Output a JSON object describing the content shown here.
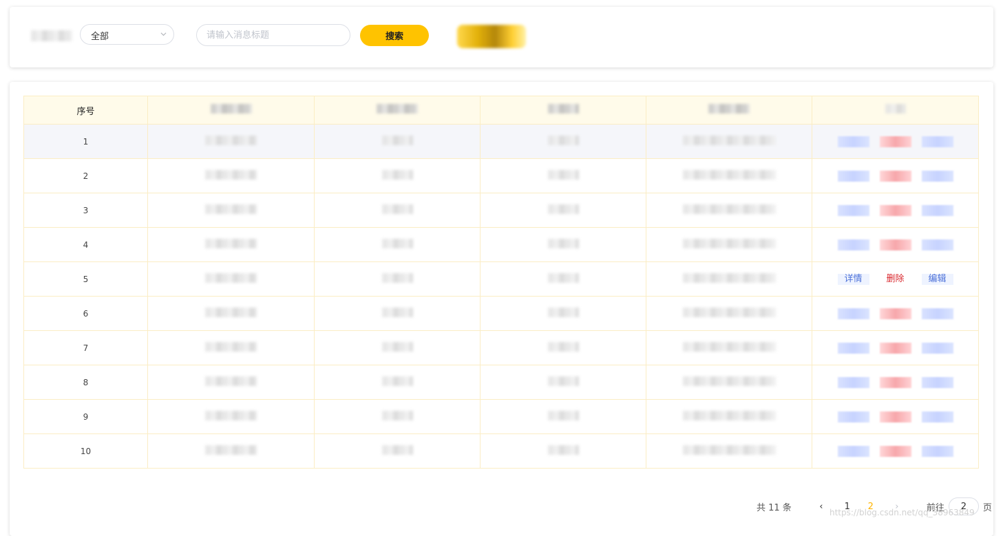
{
  "filter": {
    "status_select_value": "全部",
    "search_placeholder": "请输入消息标题",
    "search_button_label": "搜索"
  },
  "table": {
    "index_header": "序号",
    "rows": [
      {
        "index": "1"
      },
      {
        "index": "2"
      },
      {
        "index": "3"
      },
      {
        "index": "4"
      },
      {
        "index": "5",
        "ops": [
          "详情",
          "删除",
          "编辑"
        ]
      },
      {
        "index": "6"
      },
      {
        "index": "7"
      },
      {
        "index": "8"
      },
      {
        "index": "9"
      },
      {
        "index": "10"
      }
    ]
  },
  "pagination": {
    "total_label": "共 11 条",
    "pages": [
      "1",
      "2"
    ],
    "current_page": "2",
    "goto_label": "前往",
    "goto_value": "2",
    "page_suffix": "页"
  },
  "watermark": "https://blog.csdn.net/qq_38963849",
  "colors": {
    "accent": "#ffc300",
    "header_bg": "#fffbea",
    "border": "#fbedc4",
    "link_blue": "#4f73d9",
    "danger_red": "#d9292f"
  }
}
